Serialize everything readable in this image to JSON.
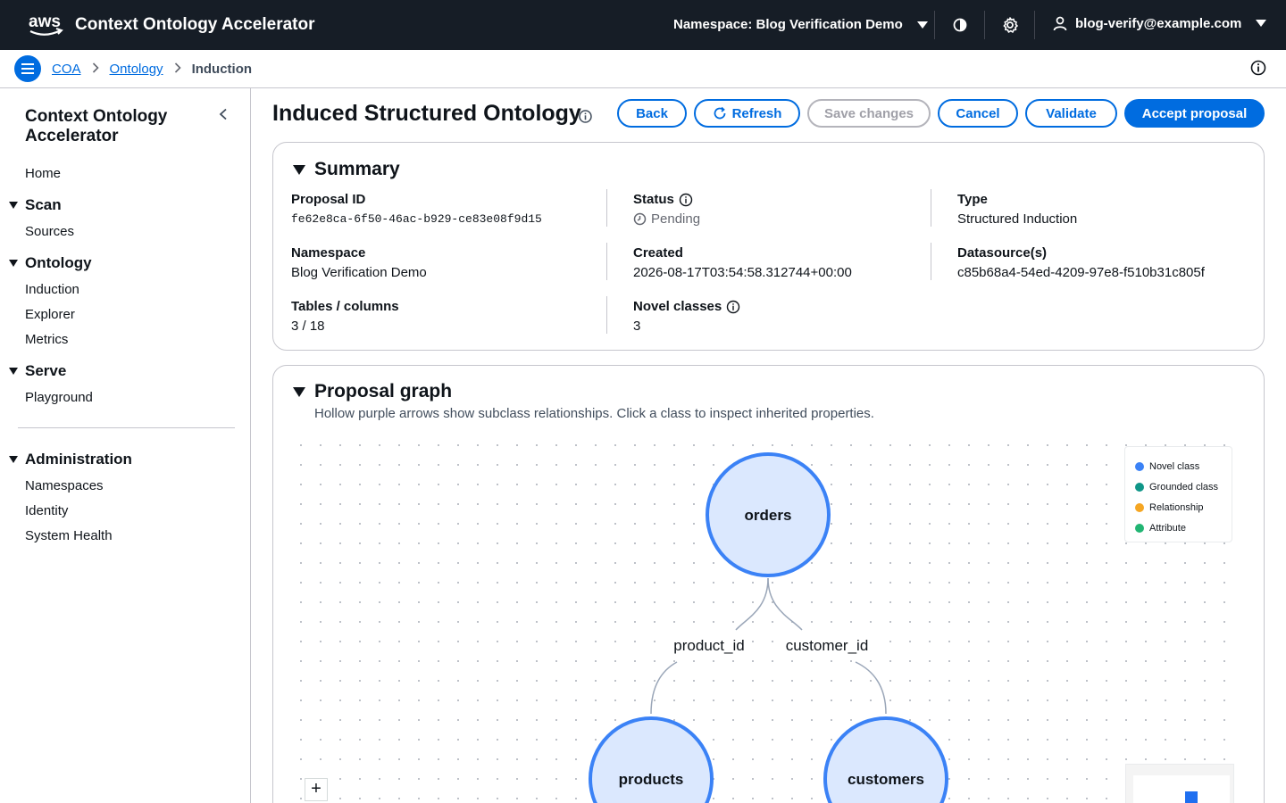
{
  "topnav": {
    "logo_text": "aws",
    "app_title": "Context Ontology Accelerator",
    "namespace_label": "Namespace: Blog Verification Demo",
    "user": "blog-verify@example.com",
    "icons": [
      "contrast-icon",
      "settings-icon",
      "user-icon"
    ]
  },
  "breadcrumb": {
    "items": [
      "COA",
      "Ontology"
    ],
    "current": "Induction"
  },
  "sidebar": {
    "title": "Context Ontology Accelerator",
    "home": "Home",
    "sections": [
      {
        "label": "Scan",
        "items": [
          "Sources"
        ]
      },
      {
        "label": "Ontology",
        "items": [
          "Induction",
          "Explorer",
          "Metrics"
        ]
      },
      {
        "label": "Serve",
        "items": [
          "Playground"
        ]
      },
      {
        "label": "Administration",
        "items": [
          "Namespaces",
          "Identity",
          "System Health"
        ]
      }
    ]
  },
  "header": {
    "title": "Induced Structured Ontology",
    "buttons": {
      "back": "Back",
      "refresh": "Refresh",
      "save": "Save changes",
      "cancel": "Cancel",
      "validate": "Validate",
      "accept": "Accept proposal"
    }
  },
  "summary": {
    "heading": "Summary",
    "proposal_id_label": "Proposal ID",
    "proposal_id": "fe62e8ca-6f50-46ac-b929-ce83e08f9d15",
    "status_label": "Status",
    "status": "Pending",
    "type_label": "Type",
    "type": "Structured Induction",
    "namespace_label": "Namespace",
    "namespace": "Blog Verification Demo",
    "created_label": "Created",
    "created": "2026-08-17T03:54:58.312744+00:00",
    "datasource_label": "Datasource(s)",
    "datasource": "c85b68a4-54ed-4209-97e8-f510b31c805f",
    "tables_label": "Tables / columns",
    "tables": "3 / 18",
    "novel_label": "Novel classes",
    "novel": "3"
  },
  "graph": {
    "heading": "Proposal graph",
    "description": "Hollow purple arrows show subclass relationships. Click a class to inspect inherited properties.",
    "nodes": [
      {
        "id": "orders",
        "label": "orders"
      },
      {
        "id": "products",
        "label": "products"
      },
      {
        "id": "customers",
        "label": "customers"
      }
    ],
    "edges": [
      {
        "from": "orders",
        "to": "products",
        "label": "product_id"
      },
      {
        "from": "orders",
        "to": "customers",
        "label": "customer_id"
      }
    ],
    "legend": [
      {
        "label": "Novel class",
        "color": "#3b82f6"
      },
      {
        "label": "Grounded class",
        "color": "#0f9688"
      },
      {
        "label": "Relationship",
        "color": "#f5a623"
      },
      {
        "label": "Attribute",
        "color": "#22b573"
      }
    ],
    "zoom_in_label": "+",
    "colors": {
      "node_fill": "#dbe8fe",
      "node_stroke": "#3b82f6",
      "edge": "#9aa6b8"
    }
  }
}
